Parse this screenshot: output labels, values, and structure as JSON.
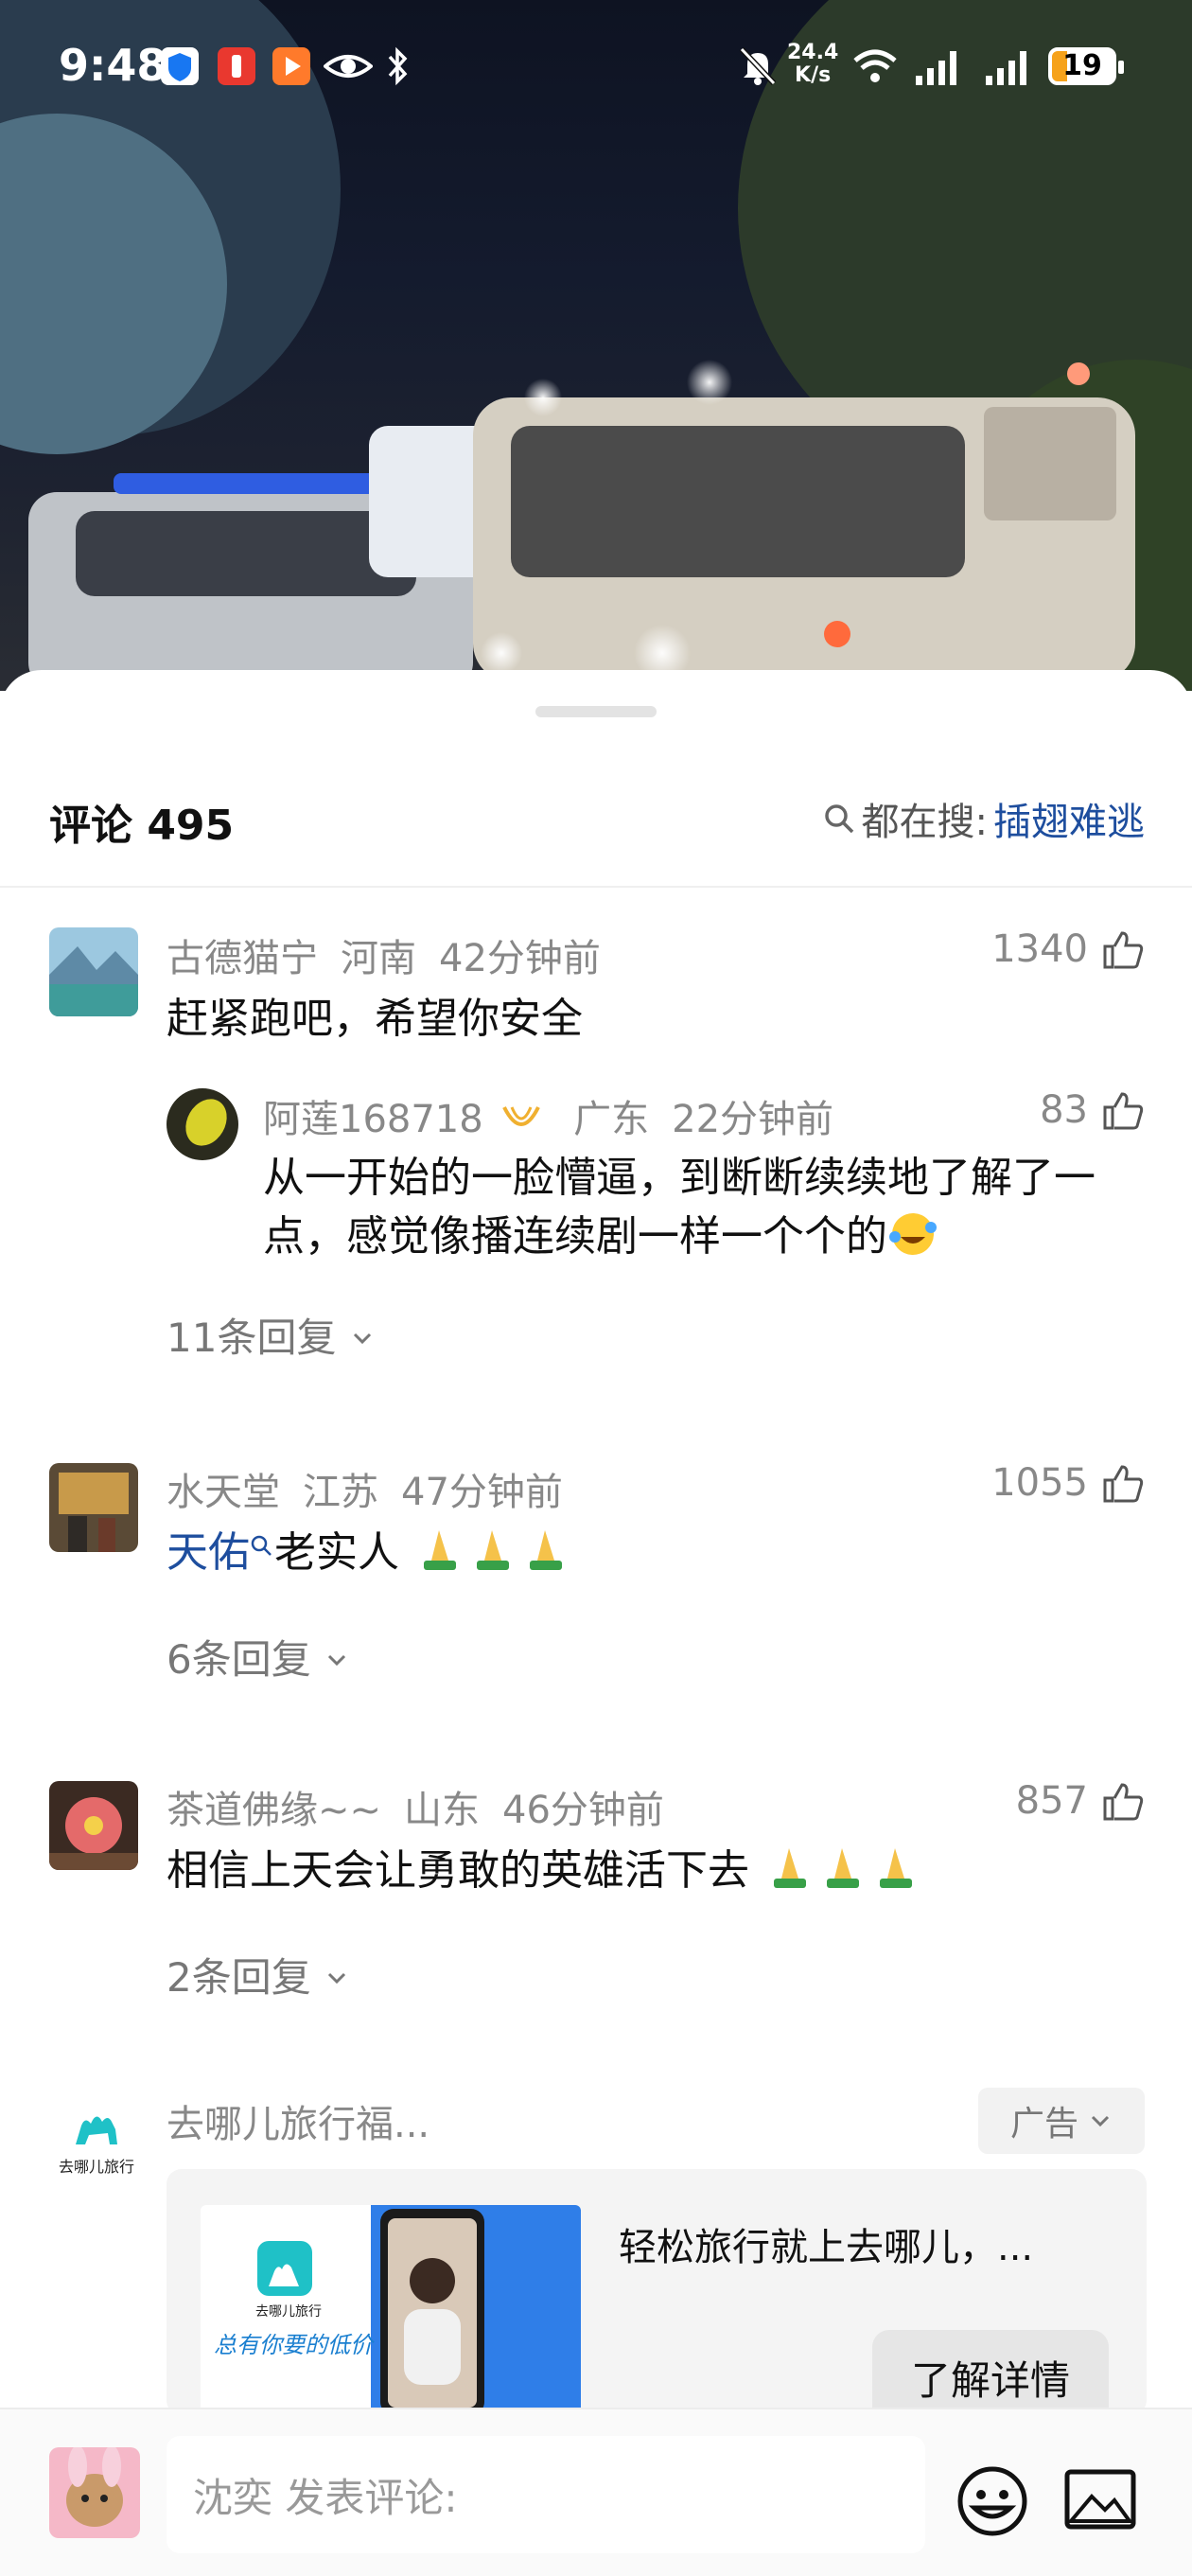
{
  "status_bar": {
    "time": "9:48",
    "net_speed_value": "24.4",
    "net_speed_unit": "K/s",
    "battery": "19"
  },
  "comments_header": {
    "count_label": "评论 495",
    "search_prefix": "都在搜:",
    "search_term": "插翅难逃"
  },
  "comments": [
    {
      "user": "古德猫宁",
      "location": "河南",
      "time": "42分钟前",
      "likes": "1340",
      "text": "赶紧跑吧，希望你安全",
      "reply": {
        "user": "阿莲168718",
        "location": "广东",
        "time": "22分钟前",
        "likes": "83",
        "text_line1": "从一开始的一脸懵逼，到断断续续地了解了一",
        "text_line2": "点，感觉像播连续剧一样一个个的"
      },
      "replies_label": "11条回复"
    },
    {
      "user": "水天堂",
      "location": "江苏",
      "time": "47分钟前",
      "likes": "1055",
      "link_text": "天佑",
      "text": "老实人",
      "replies_label": "6条回复"
    },
    {
      "user": "茶道佛缘~~",
      "location": "山东",
      "time": "46分钟前",
      "likes": "857",
      "text": "相信上天会让勇敢的英雄活下去",
      "replies_label": "2条回复"
    }
  ],
  "ad": {
    "advertiser": "去哪儿旅行福...",
    "logo_text": "去哪儿旅行",
    "tag": "广告",
    "headline": "轻松旅行就上去哪儿，...",
    "button": "了解详情",
    "image_text": "去哪儿旅行",
    "image_slogan": "总有你要的低价"
  },
  "bottom_bar": {
    "placeholder": "沈奕 发表评论:"
  },
  "colors": {
    "link_blue": "#1e4e9e",
    "battery_orange": "#f6a21a"
  }
}
